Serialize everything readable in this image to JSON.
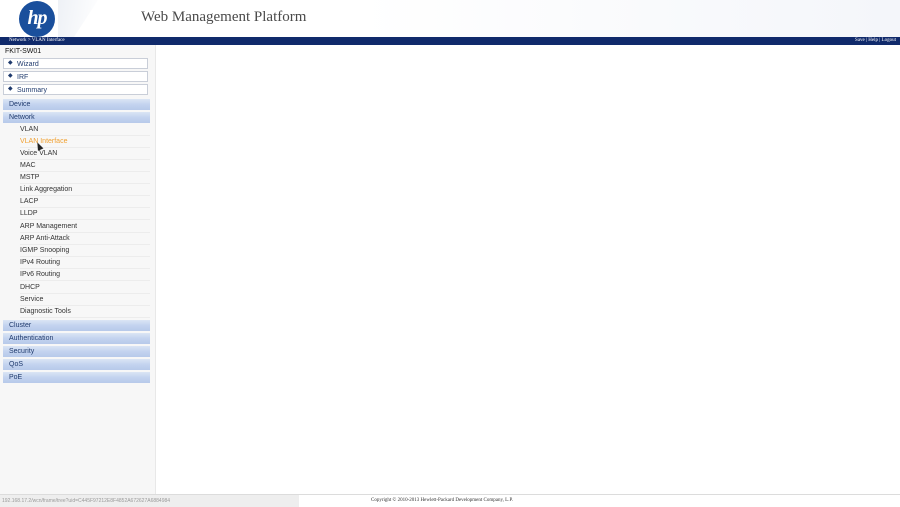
{
  "header": {
    "logo_text": "hp",
    "title": "Web Management Platform"
  },
  "navbar": {
    "breadcrumb": "Network > VLAN Interface",
    "links": [
      "Save",
      "Help",
      "Logout"
    ],
    "separator": " | "
  },
  "sidebar": {
    "device_name": "FKIT-SW01",
    "tools": [
      {
        "label": "Wizard",
        "icon": "diamond-bullet-icon"
      },
      {
        "label": "IRF",
        "icon": "diamond-bullet-icon"
      },
      {
        "label": "Summary",
        "icon": "diamond-bullet-icon"
      }
    ],
    "sections": {
      "device": "Device",
      "network": "Network",
      "cluster": "Cluster",
      "authentication": "Authentication",
      "security": "Security",
      "qos": "QoS",
      "poe": "PoE"
    },
    "network_items": [
      "VLAN",
      "VLAN Interface",
      "Voice VLAN",
      "MAC",
      "MSTP",
      "Link Aggregation",
      "LACP",
      "LLDP",
      "ARP Management",
      "ARP Anti-Attack",
      "IGMP Snooping",
      "IPv4 Routing",
      "IPv6 Routing",
      "DHCP",
      "Service",
      "Diagnostic Tools"
    ],
    "active_item": "VLAN Interface"
  },
  "footer": {
    "status_url": "192.168.17.2/wcn/frame/tree?uid=C445F97212E8F4852A672627A6884984",
    "copyright": "Copyright © 2010-2013 Hewlett-Packard Development Company, L.P."
  },
  "colors": {
    "navbar": "#102a6b",
    "logo": "#1a4f9c",
    "active_item": "#f0a030",
    "section_header": "#c3d3ef"
  }
}
